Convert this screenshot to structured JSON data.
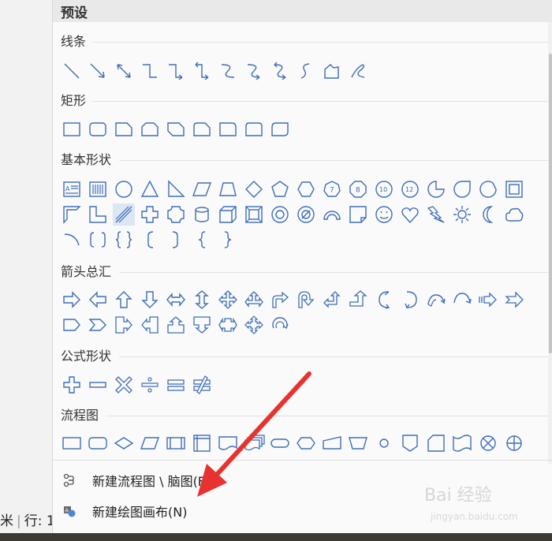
{
  "panel": {
    "title": "预设"
  },
  "sections": {
    "lines": "线条",
    "rect": "矩形",
    "basic": "基本形状",
    "arrows": "箭头总汇",
    "formula": "公式形状",
    "flow": "流程图"
  },
  "menu": {
    "new_flowchart": "新建流程图 \\ 脑图(F)",
    "new_canvas": "新建绘图画布(N)"
  },
  "status": {
    "left_char": "米",
    "row_label": "行: 1"
  },
  "watermark": {
    "brand": "Bai 经验",
    "url": "jingyan.baidu.com"
  },
  "colors": {
    "shape_stroke": "#3f6fb3",
    "arrow": "#e8322f"
  }
}
